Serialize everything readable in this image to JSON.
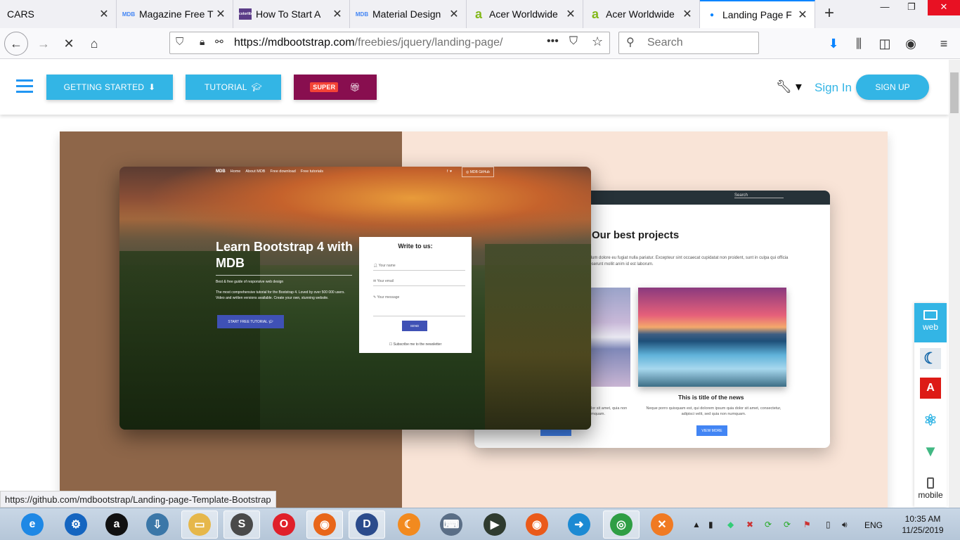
{
  "tabs": [
    {
      "title": "CARS",
      "favicon": ""
    },
    {
      "title": "Magazine Free T",
      "favicon": "MDB"
    },
    {
      "title": "How To Start A",
      "favicon": "colorlib"
    },
    {
      "title": "Material Design",
      "favicon": "MDB"
    },
    {
      "title": "Acer Worldwide",
      "favicon": "acer-icon"
    },
    {
      "title": "Acer Worldwide",
      "favicon": "acer-icon"
    },
    {
      "title": "Landing Page F",
      "favicon": "loading-icon",
      "active": true
    }
  ],
  "navbar": {
    "url_host": "https://mdbootstrap.com",
    "url_path": "/freebies/jquery/landing-page/",
    "search_placeholder": "Search"
  },
  "header": {
    "getting_started": "GETTING STARTED",
    "tutorial": "TUTORIAL",
    "super_badge": "SUPER",
    "sign_in": "Sign In",
    "sign_up": "SIGN UP"
  },
  "preview_front": {
    "brand": "MDB",
    "nav": [
      "Home",
      "About MDB",
      "Free download",
      "Free tutorials"
    ],
    "github": "MDB GitHub",
    "headline": "Learn Bootstrap 4 with MDB",
    "subline": "Best & free guide of responsive web design",
    "description": "The most comprehensive tutorial for the Bootstrap 4. Loved by over 500 000 users. Video and written versions available. Create your own, stunning website.",
    "cta": "START FREE TUTORIAL",
    "form_title": "Write to us:",
    "field_name": "Your name",
    "field_email": "Your email",
    "field_message": "Your message",
    "send": "SEND",
    "subscribe": "Subscribe me to the newsletter"
  },
  "preview_back": {
    "search": "Search",
    "title": "Our best projects",
    "intro": "cillum dolore eu fugiat nulla pariatur. Excepteur sint occaecat cupidatat non proident, sunt in culpa qui officia deserunt mollit anim id est laborum.",
    "news_title": "This is title of the news",
    "news_text": "Neque porro quisquam est, qui dolorem ipsum quia dolor sit amet, consectetur, adipisci velit, sed quia non numquam.",
    "left_text": "dolor sit amet, quia non numquam.",
    "view_more": "VIEW MORE"
  },
  "side_tabs": {
    "web": "web",
    "angular_letter": "A",
    "mobile": "mobile"
  },
  "status_url": "https://github.com/mdbootstrap/Landing-page-Template-Bootstrap",
  "taskbar": {
    "lang": "ENG",
    "time": "10:35 AM",
    "date": "11/25/2019",
    "apps": [
      {
        "name": "internet-explorer-icon",
        "color": "#1e88e5",
        "glyph": "e"
      },
      {
        "name": "control-panel-icon",
        "color": "#1565c0",
        "glyph": "⚙"
      },
      {
        "name": "amazon-icon",
        "color": "#111111",
        "glyph": "a"
      },
      {
        "name": "python-installer-icon",
        "color": "#3b77a8",
        "glyph": "⇩"
      },
      {
        "name": "file-explorer-icon",
        "color": "#e6b74a",
        "glyph": "▭"
      },
      {
        "name": "sublime-text-icon",
        "color": "#4a4a4a",
        "glyph": "S"
      },
      {
        "name": "opera-icon",
        "color": "#e0202a",
        "glyph": "O"
      },
      {
        "name": "firefox-icon",
        "color": "#e8661a",
        "glyph": "◉"
      },
      {
        "name": "dev-cpp-icon",
        "color": "#2b4b8c",
        "glyph": "D"
      },
      {
        "name": "uc-browser-icon",
        "color": "#f28a1f",
        "glyph": "☾"
      },
      {
        "name": "keyboard-icon",
        "color": "#5a6e86",
        "glyph": "⌨"
      },
      {
        "name": "python-icon",
        "color": "#2f3b2f",
        "glyph": "▶"
      },
      {
        "name": "firefox-alt-icon",
        "color": "#ea5a1a",
        "glyph": "◉"
      },
      {
        "name": "share-icon",
        "color": "#1c8ad3",
        "glyph": "➜"
      },
      {
        "name": "chrome-icon",
        "color": "#2f9e44",
        "glyph": "◎"
      },
      {
        "name": "xampp-icon",
        "color": "#f07a23",
        "glyph": "✕"
      }
    ]
  }
}
